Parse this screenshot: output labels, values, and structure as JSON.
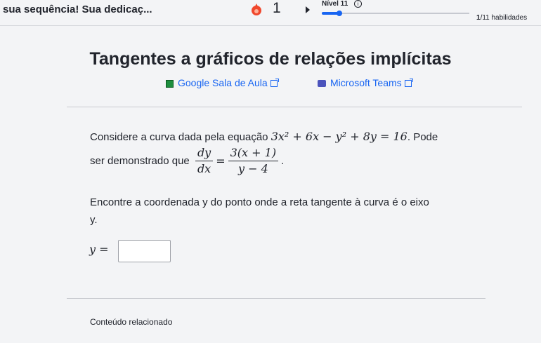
{
  "topbar": {
    "streak_text": "sua sequência! Sua dedicaç...",
    "streak_count": "1",
    "level_label": "Nível 11",
    "info_glyph": "i",
    "skills_current": "1",
    "skills_rest": "/11 habilidades",
    "progress_fraction": 0.12,
    "icons": [
      "flame-icon",
      "play-icon",
      "info-icon"
    ]
  },
  "title": "Tangentes a gráficos de relações implícitas",
  "links": {
    "google_classroom": "Google Sala de Aula",
    "microsoft_teams": "Microsoft Teams",
    "icons": [
      "google-classroom-icon",
      "microsoft-teams-icon",
      "external-link-icon"
    ]
  },
  "problem": {
    "intro_text": "Considere a curva dada pela equação",
    "equation": "3x² + 6x − y² + 8y = 16",
    "after_equation": ". Pode",
    "line2_text": "ser demonstrado que",
    "derivative_num": "dy",
    "derivative_den": "dx",
    "equals": "=",
    "rhs_num": "3(x + 1)",
    "rhs_den": "y − 4",
    "line2_end": ".",
    "question_line1": "Encontre a coordenada y do ponto onde a reta tangente à curva é o eixo",
    "question_line2": "y."
  },
  "answer": {
    "label": "y =",
    "value": ""
  },
  "related": {
    "label": "Conteúdo relacionado"
  },
  "colors": {
    "accent": "#1865f2",
    "text": "#21242c",
    "flame": "#f0472c",
    "background": "#f3f4f6"
  }
}
